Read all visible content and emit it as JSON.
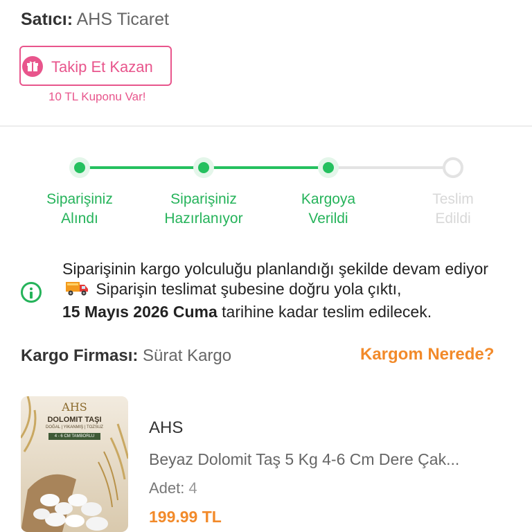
{
  "seller": {
    "label": "Satıcı:",
    "name": "AHS Ticaret"
  },
  "follow": {
    "button_label": "Takip Et Kazan",
    "coupon_note": "10 TL Kuponu Var!",
    "icon": "gift-icon"
  },
  "tracker": {
    "steps": [
      {
        "label": "Siparişiniz\nAlındı",
        "status": "done"
      },
      {
        "label": "Siparişiniz\nHazırlanıyor",
        "status": "done"
      },
      {
        "label": "Kargoya\nVerildi",
        "status": "done"
      },
      {
        "label": "Teslim\nEdildi",
        "status": "pending"
      }
    ],
    "colors": {
      "done": "#25c05f",
      "pending": "#e3e3e3"
    }
  },
  "notice": {
    "icon": "info-icon",
    "text_part1": "Siparişinin kargo yolculuğu planlandığı şekilde devam ediyor",
    "truck_icon": "delivery-truck-icon",
    "text_part2": " Siparişin teslimat şubesine doğru yola çıktı,",
    "date": "15 Mayıs 2026 Cuma",
    "text_part3": " tarihine kadar teslim edilecek."
  },
  "cargo": {
    "label": "Kargo Firması:",
    "company": "Sürat Kargo",
    "where_link": "Kargom Nerede?"
  },
  "product": {
    "image_texts": {
      "brand": "AHS",
      "title": "DOLOMIT TAŞI",
      "sub": "DOĞAL | YIKANMIŞ | TOZSUZ",
      "size": "4 - 6 CM TAMBORLU"
    },
    "brand": "AHS",
    "name": "Beyaz Dolomit Taş 5 Kg 4-6 Cm Dere Çak...",
    "qty_label": "Adet:",
    "qty": "4",
    "price": "199.99 TL"
  },
  "colors": {
    "accent_green": "#25c05f",
    "accent_pink": "#e8558c",
    "accent_orange": "#f28a2a"
  }
}
